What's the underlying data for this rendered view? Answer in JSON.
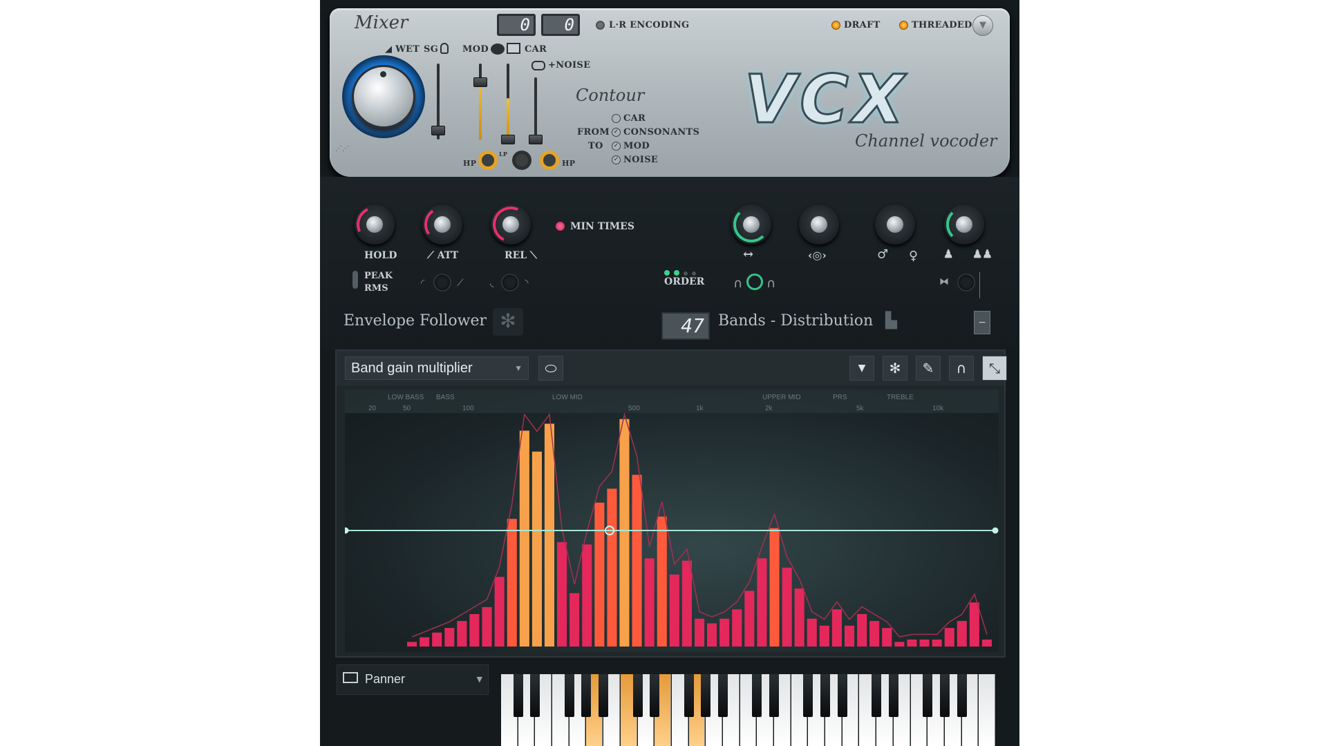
{
  "header": {
    "mixer_title": "Mixer",
    "wet_label": "WET",
    "sg_label": "SG",
    "mod_label": "MOD",
    "car_label": "CAR",
    "noise_label": "+NOISE",
    "hp_label_left": "HP",
    "lp_label": "LP",
    "hp_label_right": "HP",
    "lcd_left": "0",
    "lcd_right": "0",
    "lr_encoding_label": "L·R ENCODING",
    "draft_label": "DRAFT",
    "threaded_label": "THREADED"
  },
  "contour": {
    "title": "Contour",
    "from_label": "FROM",
    "to_label": "TO",
    "options": [
      {
        "label": "CAR",
        "checked": false
      },
      {
        "label": "CONSONANTS",
        "checked": true
      },
      {
        "label": "MOD",
        "checked": true
      },
      {
        "label": "NOISE",
        "checked": true
      }
    ]
  },
  "brand": {
    "logo_text": "VCX",
    "subtitle": "Channel vocoder"
  },
  "envelope": {
    "hold_label": "HOLD",
    "att_label": "ATT",
    "rel_label": "REL",
    "min_times_label": "MIN TIMES",
    "peak_label": "PEAK",
    "rms_label": "RMS",
    "section_title": "Envelope Follower"
  },
  "bands": {
    "order_label": "ORDER",
    "count": "47",
    "section_title": "Bands - Distribution"
  },
  "graph": {
    "selector_label": "Band gain multiplier",
    "region_labels": [
      "LOW BASS",
      "BASS",
      "LOW MID",
      "UPPER MID",
      "PRS",
      "TREBLE"
    ],
    "freq_labels": [
      "20",
      "50",
      "100",
      "500",
      "1k",
      "2k",
      "5k",
      "10k"
    ]
  },
  "bottom": {
    "panner_label": "Panner"
  },
  "chart_data": {
    "type": "bar",
    "bands": 47,
    "values": [
      0.02,
      0.04,
      0.06,
      0.08,
      0.11,
      0.14,
      0.17,
      0.3,
      0.55,
      0.93,
      0.84,
      0.96,
      0.45,
      0.23,
      0.44,
      0.62,
      0.68,
      0.98,
      0.74,
      0.38,
      0.56,
      0.31,
      0.37,
      0.12,
      0.1,
      0.12,
      0.16,
      0.24,
      0.38,
      0.51,
      0.34,
      0.25,
      0.12,
      0.09,
      0.16,
      0.09,
      0.14,
      0.11,
      0.08,
      0.02,
      0.03,
      0.03,
      0.03,
      0.08,
      0.11,
      0.19,
      0.03
    ],
    "gain_multiplier_level": 0.5
  }
}
